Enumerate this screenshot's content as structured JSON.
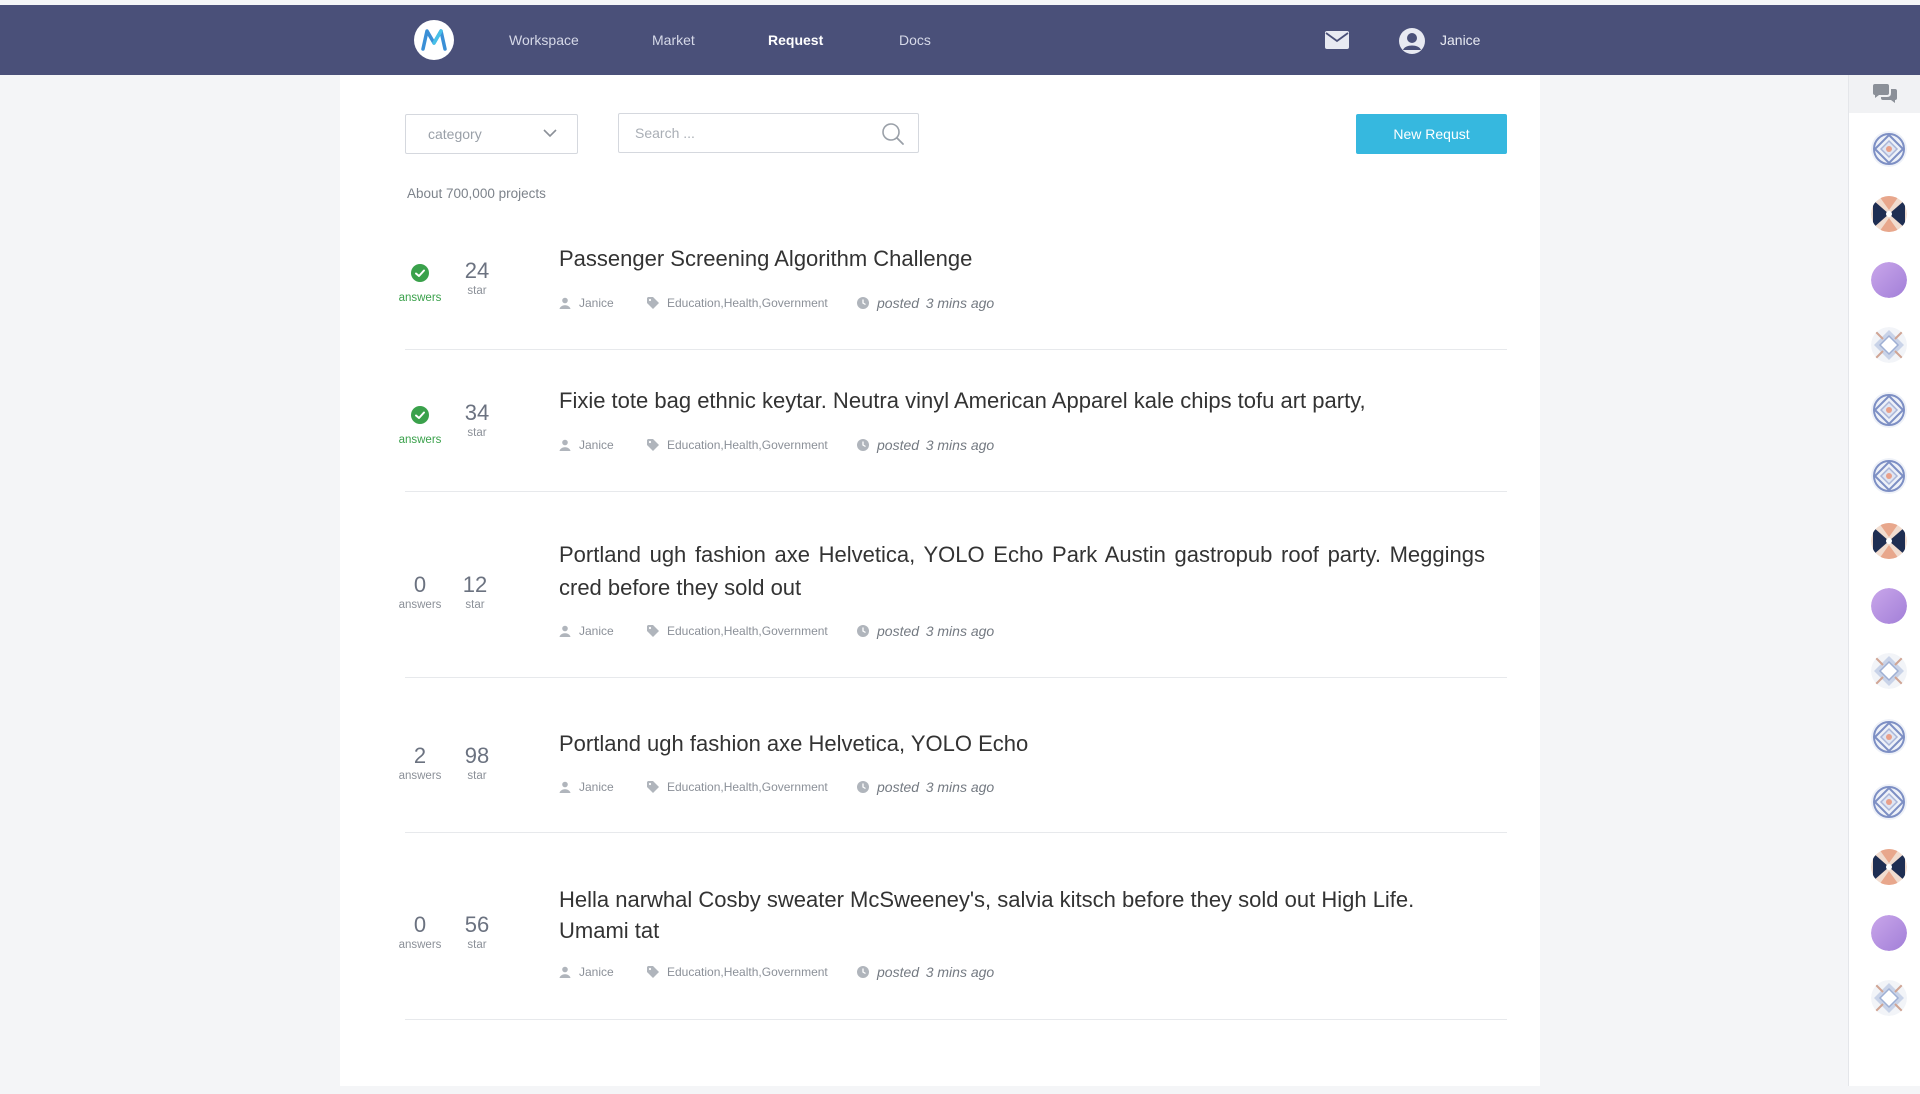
{
  "header": {
    "nav": [
      {
        "label": "Workspace",
        "active": false
      },
      {
        "label": "Market",
        "active": false
      },
      {
        "label": "Request",
        "active": true
      },
      {
        "label": "Docs",
        "active": false
      }
    ],
    "user_name": "Janice",
    "bg_color": "#4a5079"
  },
  "toolbar": {
    "category_label": "category",
    "search_placeholder": "Search ...",
    "new_button": "New Requst"
  },
  "count_text": "About 700,000 projects",
  "requests": [
    {
      "answers": "",
      "answered": true,
      "stars": "24",
      "answers_label": "answers",
      "stars_label": "star",
      "title": "Passenger Screening Algorithm Challenge",
      "author": "Janice",
      "tags": "Education,Health,Government",
      "posted_label": "posted",
      "posted_time": "3 mins ago"
    },
    {
      "answers": "",
      "answered": true,
      "stars": "34",
      "answers_label": "answers",
      "stars_label": "star",
      "title": "Fixie tote bag ethnic keytar. Neutra vinyl American Apparel kale chips tofu art party,",
      "author": "Janice",
      "tags": "Education,Health,Government",
      "posted_label": "posted",
      "posted_time": "3 mins ago"
    },
    {
      "answers": "0",
      "answered": false,
      "stars": "12",
      "answers_label": "answers",
      "stars_label": "star",
      "title": "Portland ugh fashion axe Helvetica, YOLO Echo Park Austin gastropub roof party. Meggings cred before they sold out",
      "author": "Janice",
      "tags": "Education,Health,Government",
      "posted_label": "posted",
      "posted_time": "3 mins ago"
    },
    {
      "answers": "2",
      "answered": false,
      "stars": "98",
      "answers_label": "answers",
      "stars_label": "star",
      "title": "Portland ugh fashion axe Helvetica, YOLO Echo",
      "author": "Janice",
      "tags": "Education,Health,Government",
      "posted_label": "posted",
      "posted_time": "3 mins ago"
    },
    {
      "answers": "0",
      "answered": false,
      "stars": "56",
      "answers_label": "answers",
      "stars_label": "star",
      "title": "Hella narwhal Cosby sweater McSweeney's, salvia kitsch before they sold out High Life. Umami tat",
      "author": "Janice",
      "tags": "Education,Health,Government",
      "posted_label": "posted",
      "posted_time": "3 mins ago"
    }
  ],
  "sidebar_avatars": [
    "pattern-blue",
    "pattern-x",
    "purple",
    "pattern-diamond",
    "pattern-blue",
    "pattern-blue",
    "pattern-x",
    "purple",
    "pattern-diamond",
    "pattern-blue",
    "pattern-blue",
    "pattern-x",
    "purple",
    "pattern-diamond"
  ],
  "colors": {
    "accent": "#36b8df",
    "answered_green": "#3aa14b"
  }
}
